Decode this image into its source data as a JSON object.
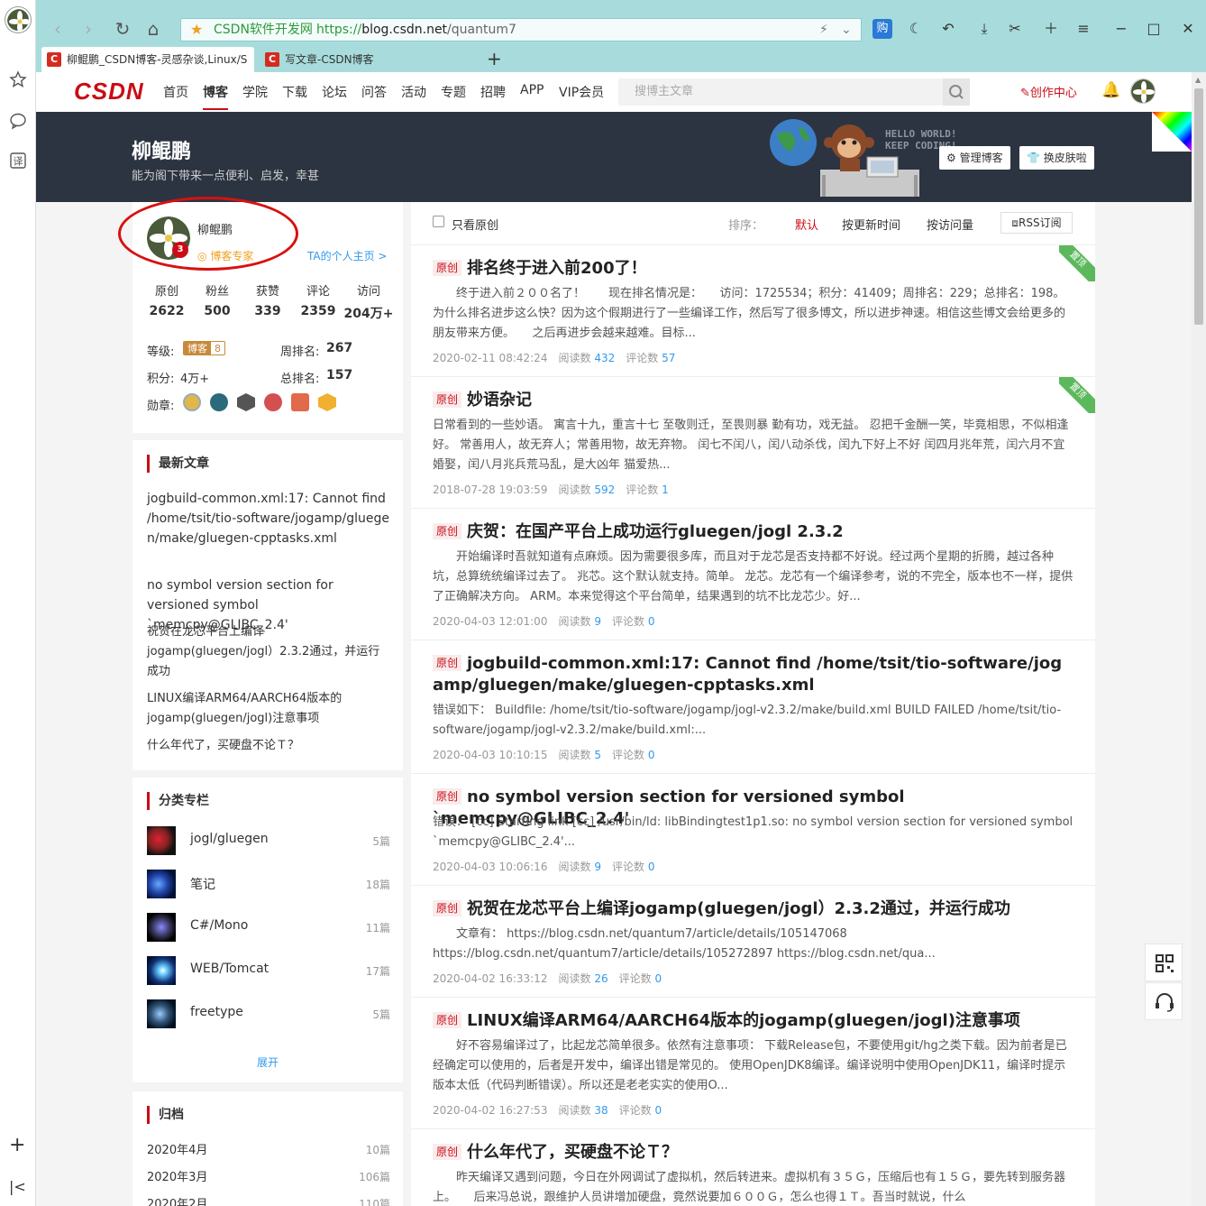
{
  "browser": {
    "site_name": "CSDN软件开发网",
    "url_prefix": "https://",
    "url_host": "blog.csdn.net",
    "url_path": "/quantum7",
    "tabs": [
      {
        "label": "柳鲲鹏_CSDN博客-灵感杂谈,Linux/S"
      },
      {
        "label": "写文章-CSDN博客"
      }
    ],
    "new_tab": "+"
  },
  "nav": {
    "logo": "CSDN",
    "items": [
      "首页",
      "博客",
      "学院",
      "下载",
      "论坛",
      "问答",
      "活动",
      "专题",
      "招聘",
      "APP",
      "VIP会员"
    ],
    "search_placeholder": "搜博主文章",
    "create": "创作中心"
  },
  "banner": {
    "name": "柳鲲鹏",
    "motto": "能为阁下带来一点便利、启发，幸甚",
    "hello": "HELLO WORLD!",
    "keep": "KEEP CODING!",
    "manage": "管理博客",
    "skin": "换皮肤啦"
  },
  "profile": {
    "name": "柳鲲鹏",
    "tag": "博客专家",
    "home_link": "TA的个人主页 >",
    "stats": [
      {
        "k": "原创",
        "v": "2622"
      },
      {
        "k": "粉丝",
        "v": "500"
      },
      {
        "k": "获赞",
        "v": "339"
      },
      {
        "k": "评论",
        "v": "2359"
      },
      {
        "k": "访问",
        "v": "204万+"
      }
    ],
    "level_label": "等级:",
    "level_badge": "博客",
    "level_num": "8",
    "week_rank_label": "周排名:",
    "week_rank": "267",
    "points_label": "积分:",
    "points": "4万+",
    "total_rank_label": "总排名:",
    "total_rank": "157",
    "medals_label": "勋章:"
  },
  "latest": {
    "title": "最新文章",
    "items": [
      "jogbuild-common.xml:17: Cannot find /home/tsit/tio-software/jogamp/gluegen/make/gluegen-cpptasks.xml",
      "no symbol version section for versioned symbol `memcpy@GLIBC_2.4'",
      "祝贺在龙芯平台上编译jogamp(gluegen/jogl）2.3.2通过，并运行成功",
      "LINUX编译ARM64/AARCH64版本的jogamp(gluegen/jogl)注意事项",
      "什么年代了，买硬盘不论Ｔ？"
    ]
  },
  "categories": {
    "title": "分类专栏",
    "items": [
      {
        "name": "jogl/gluegen",
        "count": "5篇"
      },
      {
        "name": "笔记",
        "count": "18篇"
      },
      {
        "name": "C#/Mono",
        "count": "11篇"
      },
      {
        "name": "WEB/Tomcat",
        "count": "17篇"
      },
      {
        "name": "freetype",
        "count": "5篇"
      }
    ],
    "expand": "展开"
  },
  "archive": {
    "title": "归档",
    "items": [
      {
        "month": "2020年4月",
        "count": "10篇"
      },
      {
        "month": "2020年3月",
        "count": "106篇"
      },
      {
        "month": "2020年2月",
        "count": "110篇"
      }
    ]
  },
  "list": {
    "only_original": "只看原创",
    "sort_label": "排序：",
    "sort_default": "默认",
    "sort_time": "按更新时间",
    "sort_visits": "按访问量",
    "rss": "RSS订阅",
    "badge": "原创",
    "pin": "置顶",
    "read_label": "阅读数",
    "comment_label": "评论数",
    "articles": [
      {
        "title": "排名终于进入前200了！",
        "desc": "终于进入前２００名了！　　现在排名情况是：　　访问：1725534；积分：41409；周排名：229；总排名：198。　　为什么排名进步这么快？因为这个假期进行了一些编译工作，然后写了很多博文，所以进步神速。相信这些博文会给更多的朋友带来方便。　　之后再进步会越来越难。目标...",
        "date": "2020-02-11 08:42:24",
        "reads": "432",
        "comments": "57",
        "pinned": true
      },
      {
        "title": "妙语杂记",
        "desc": "日常看到的一些妙语。 寓言十九，重言十七 至敬则迁，至畏则暴 勤有功，戏无益。 忍把千金酬一笑，毕竟相思，不似相逢好。 常善用人，故无弃人；常善用物，故无弃物。 闰七不闰八，闰八动杀伐，闰九下好上不好 闰四月兆年荒，闰六月不宜婚娶，闰八月兆兵荒马乱，是大凶年 猫爱热...",
        "date": "2018-07-28 19:03:59",
        "reads": "592",
        "comments": "1",
        "pinned": true
      },
      {
        "title": "庆贺：在国产平台上成功运行gluegen/jogl 2.3.2",
        "desc": "开始编译时吾就知道有点麻烦。因为需要很多库，而且对于龙芯是否支持都不好说。经过两个星期的折腾，越过各种坑，总算统统编译过去了。 兆芯。这个默认就支持。简单。 龙芯。龙芯有一个编译参考，说的不完全，版本也不一样，提供了正确解决方向。 ARM。本来觉得这个平台简单，结果遇到的坑不比龙芯少。好...",
        "date": "2020-04-03 12:01:00",
        "reads": "9",
        "comments": "0",
        "pinned": false
      },
      {
        "title": "jogbuild-common.xml:17: Cannot find /home/tsit/tio-software/jogamp/gluegen/make/gluegen-cpptasks.xml",
        "desc": "错误如下： Buildfile: /home/tsit/tio-software/jogamp/jogl-v2.3.2/make/build.xml BUILD FAILED /home/tsit/tio-software/jogamp/jogl-v2.3.2/make/build.xml:...",
        "date": "2020-04-03 10:10:15",
        "reads": "5",
        "comments": "0",
        "pinned": false
      },
      {
        "title": "no symbol version section for versioned symbol `memcpy@GLIBC_2.4'",
        "desc": "错误： [cc] Starting link [cc] /usr/bin/ld: libBindingtest1p1.so: no symbol version section for versioned symbol `memcpy@GLIBC_2.4'...",
        "date": "2020-04-03 10:06:16",
        "reads": "9",
        "comments": "0",
        "pinned": false
      },
      {
        "title": "祝贺在龙芯平台上编译jogamp(gluegen/jogl）2.3.2通过，并运行成功",
        "desc": "文章有： https://blog.csdn.net/quantum7/article/details/105147068 https://blog.csdn.net/quantum7/article/details/105272897 https://blog.csdn.net/qua...",
        "date": "2020-04-02 16:33:12",
        "reads": "26",
        "comments": "0",
        "pinned": false
      },
      {
        "title": "LINUX编译ARM64/AARCH64版本的jogamp(gluegen/jogl)注意事项",
        "desc": "好不容易编译过了，比起龙芯简单很多。依然有注意事项： 下载Release包，不要使用git/hg之类下载。因为前者是已经确定可以使用的，后者是开发中，编译出错是常见的。 使用OpenJDK8编译。编译说明中使用OpenJDK11，编译时提示版本太低（代码判断错误）。所以还是老老实实的使用O...",
        "date": "2020-04-02 16:27:53",
        "reads": "38",
        "comments": "0",
        "pinned": false
      },
      {
        "title": "什么年代了，买硬盘不论Ｔ？",
        "desc": "昨天编译又遇到问题，今日在外网调试了虚拟机，然后转进来。虚拟机有３５Ｇ，压缩后也有１５Ｇ，要先转到服务器上。　　后来冯总说，跟维护人员讲增加硬盘，竟然说要加６００Ｇ，怎么也得１Ｔ。吾当时就说，什么",
        "date": "",
        "reads": "",
        "comments": "",
        "pinned": false
      }
    ]
  }
}
